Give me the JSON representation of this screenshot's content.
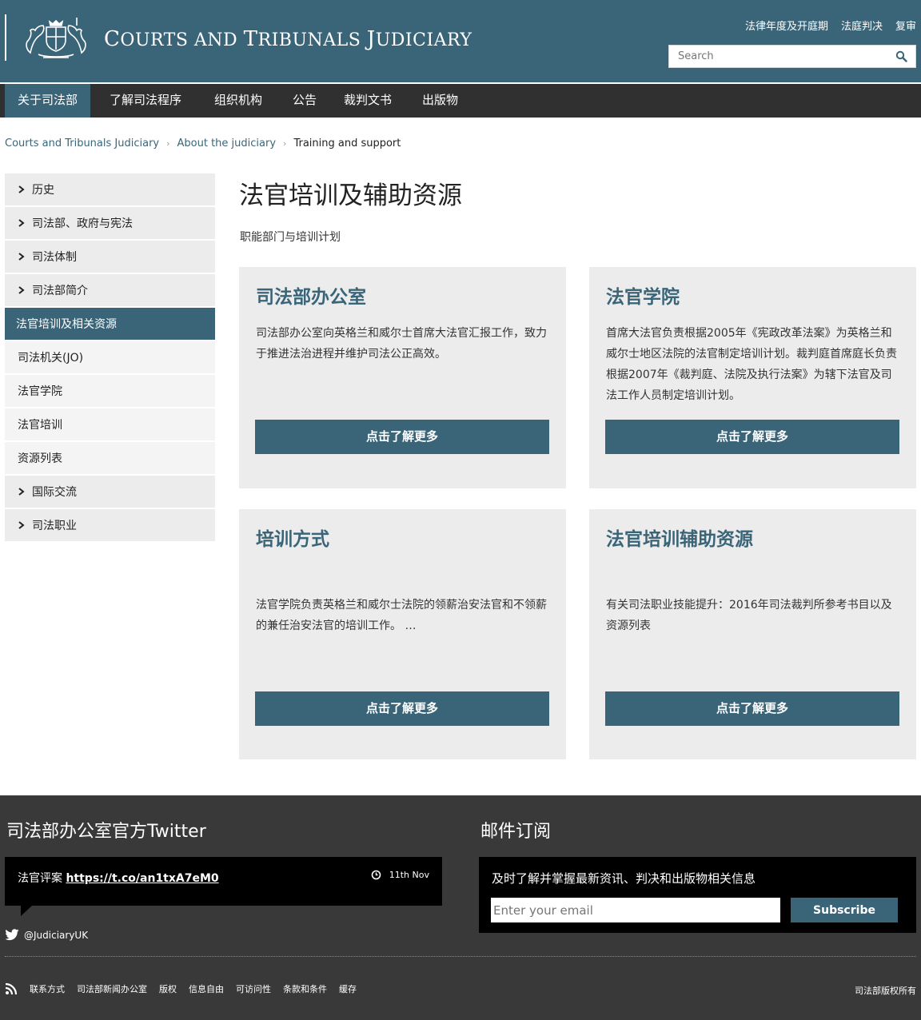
{
  "header": {
    "site_title_first_C": "C",
    "site_title_ourts": "OURTS AND ",
    "site_title_T": "T",
    "site_title_ribunals": "RIBUNALS ",
    "site_title_J": "J",
    "site_title_udiciary": "UDICIARY",
    "top_links": [
      "法律年度及开庭期",
      "法庭判决",
      "复审"
    ],
    "search_placeholder": "Search"
  },
  "nav": {
    "items": [
      "关于司法部",
      "了解司法程序",
      "组织机构",
      "公告",
      "裁判文书",
      "出版物"
    ]
  },
  "breadcrumb": {
    "items": [
      "Courts and Tribunals Judiciary",
      "About the judiciary"
    ],
    "current": "Training and support"
  },
  "sidebar": {
    "items": [
      "历史",
      "司法部、政府与宪法",
      "司法体制",
      "司法部简介"
    ],
    "active": "法官培训及相关资源",
    "sub_items": [
      "司法机关(JO)",
      "法官学院",
      "法官培训",
      "资源列表"
    ],
    "items_after": [
      "国际交流",
      "司法职业"
    ]
  },
  "main": {
    "title": "法官培训及辅助资源",
    "subtitle": "职能部门与培训计划",
    "cards": [
      {
        "title": "司法部办公室",
        "text": "司法部办公室向英格兰和威尔士首席大法官汇报工作，致力于推进法治进程并维护司法公正高效。",
        "button": "点击了解更多"
      },
      {
        "title": "法官学院",
        "text": "首席大法官负责根据2005年《宪政改革法案》为英格兰和威尔士地区法院的法官制定培训计划。裁判庭首席庭长负责根据2007年《裁判庭、法院及执行法案》为辖下法官及司法工作人员制定培训计划。",
        "button": "点击了解更多"
      },
      {
        "title": "培训方式",
        "text": "法官学院负责英格兰和威尔士法院的领薪治安法官和不领薪的兼任治安法官的培训工作。 …",
        "button": "点击了解更多"
      },
      {
        "title": "法官培训辅助资源",
        "text": "有关司法职业技能提升：2016年司法裁判所参考书目以及资源列表",
        "button": "点击了解更多"
      }
    ]
  },
  "footer": {
    "twitter_heading": "司法部办公室官方Twitter",
    "tweet_prefix": "法官评案 ",
    "tweet_link": "https://t.co/an1txA7eM0",
    "tweet_time": "11th Nov",
    "twitter_handle": "@JudiciaryUK",
    "mail_heading": "邮件订阅",
    "mail_desc": "及时了解并掌握最新资讯、判决和出版物相关信息",
    "mail_placeholder": "Enter your email",
    "subscribe_label": "Subscribe",
    "bottom_links": [
      "联系方式",
      "司法部新闻办公室",
      "版权",
      "信息自由",
      "可访问性",
      "条款和条件",
      "缓存"
    ],
    "copyright": "司法部版权所有"
  },
  "colors": {
    "brand": "#3a6579",
    "nav_bg": "#303030",
    "footer_bg": "#393939",
    "card_bg": "#ececec"
  }
}
